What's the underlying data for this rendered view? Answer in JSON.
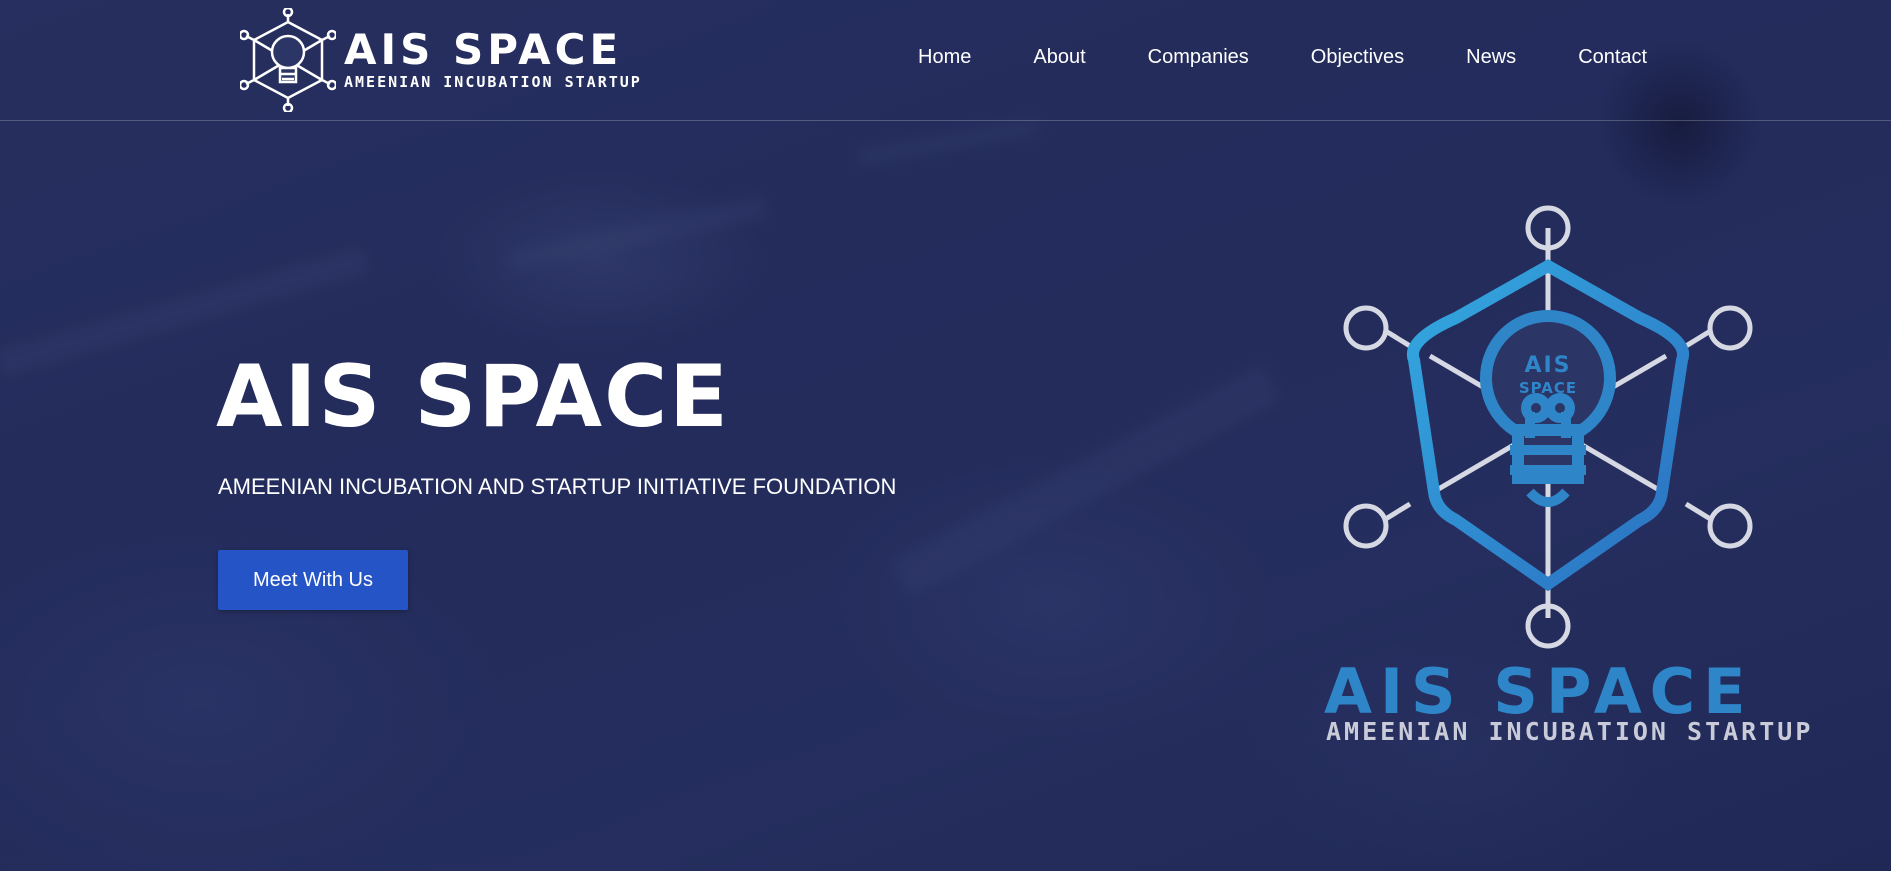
{
  "brand": {
    "name": "AIS SPACE",
    "tagline": "AMEENIAN INCUBATION STARTUP",
    "logo_icon": "lightbulb-network-icon",
    "bulb_text": "AIS SPACE"
  },
  "nav": {
    "items": [
      {
        "label": "Home"
      },
      {
        "label": "About"
      },
      {
        "label": "Companies"
      },
      {
        "label": "Objectives"
      },
      {
        "label": "News"
      },
      {
        "label": "Contact"
      }
    ]
  },
  "hero": {
    "title": "AIS SPACE",
    "subtitle": "AMEENIAN INCUBATION AND STARTUP INITIATIVE FOUNDATION",
    "cta_label": "Meet With Us"
  },
  "hero_logo": {
    "icon": "lightbulb-network-icon",
    "name": "AIS SPACE",
    "tagline": "AMEENIAN INCUBATION STARTUP"
  },
  "colors": {
    "background": "#27305f",
    "cta": "#2554c7",
    "logo_blue": "#2e86c9",
    "text": "#ffffff"
  }
}
